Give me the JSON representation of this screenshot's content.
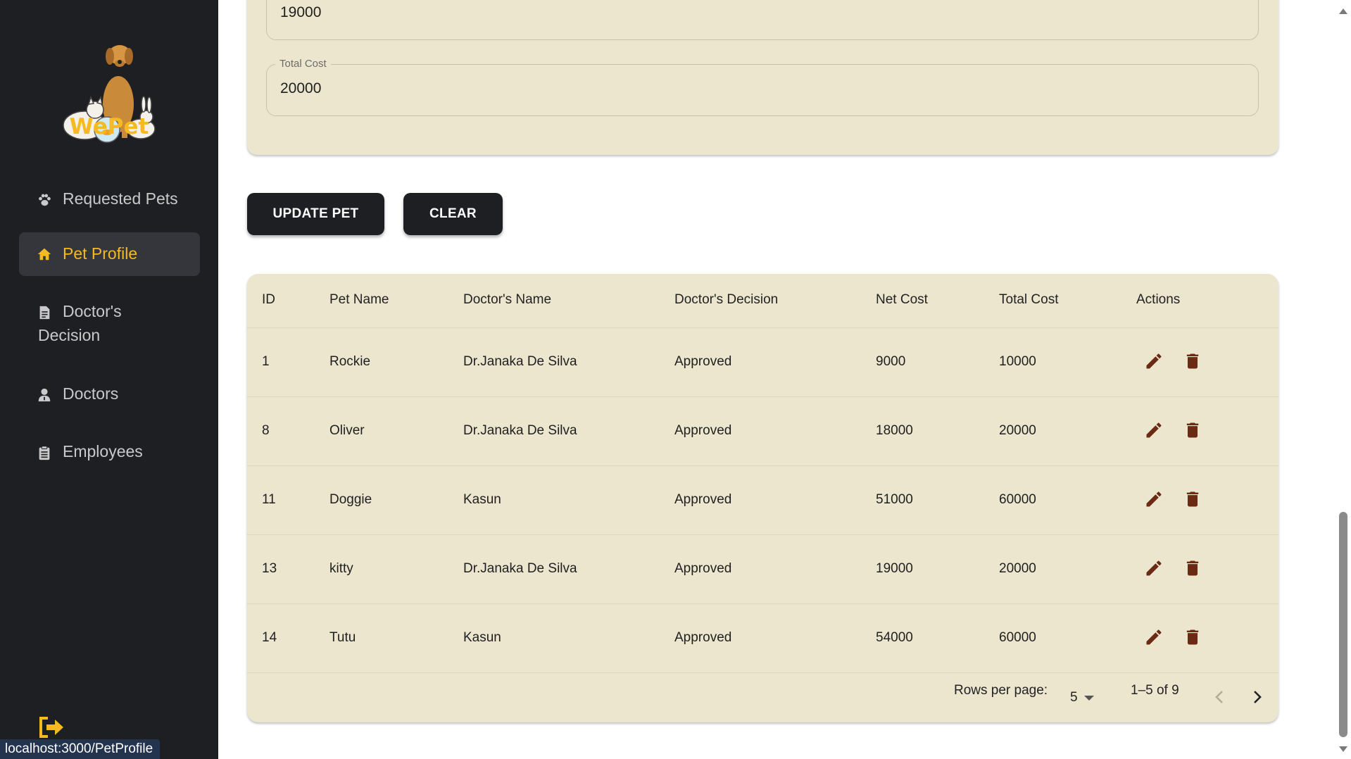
{
  "app": {
    "brand": "WePet"
  },
  "sidebar": {
    "items": [
      {
        "label": "Requested Pets",
        "icon": "paw-icon",
        "active": false
      },
      {
        "label": "Pet Profile",
        "icon": "home-icon",
        "active": true
      },
      {
        "label_line1": "Doctor's",
        "label_line2": "Decision",
        "icon": "document-icon",
        "active": false
      },
      {
        "label": "Doctors",
        "icon": "doctor-icon",
        "active": false
      },
      {
        "label": "Employees",
        "icon": "clipboard-icon",
        "active": false
      }
    ],
    "logout_icon": "logout-icon"
  },
  "form": {
    "net_cost_value": "19000",
    "total_cost_label": "Total Cost",
    "total_cost_value": "20000"
  },
  "buttons": {
    "update": "UPDATE PET",
    "clear": "CLEAR"
  },
  "table": {
    "headers": [
      "ID",
      "Pet Name",
      "Doctor's Name",
      "Doctor's Decision",
      "Net Cost",
      "Total Cost",
      "Actions"
    ],
    "rows": [
      [
        "1",
        "Rockie",
        "Dr.Janaka De Silva",
        "Approved",
        "9000",
        "10000"
      ],
      [
        "8",
        "Oliver",
        "Dr.Janaka De Silva",
        "Approved",
        "18000",
        "20000"
      ],
      [
        "11",
        "Doggie",
        "Kasun",
        "Approved",
        "51000",
        "60000"
      ],
      [
        "13",
        "kitty",
        "Dr.Janaka De Silva",
        "Approved",
        "19000",
        "20000"
      ],
      [
        "14",
        "Tutu",
        "Kasun",
        "Approved",
        "54000",
        "60000"
      ]
    ],
    "rows_per_page_label": "Rows per page:",
    "rows_per_page_value": "5",
    "range_text": "1–5 of 9"
  },
  "status_bar": {
    "url": "localhost:3000/PetProfile"
  },
  "colors": {
    "sidebar_bg": "#1e1f23",
    "accent": "#f5b921",
    "card_bg": "#ece6cf",
    "action_icon": "#6b2a14"
  }
}
